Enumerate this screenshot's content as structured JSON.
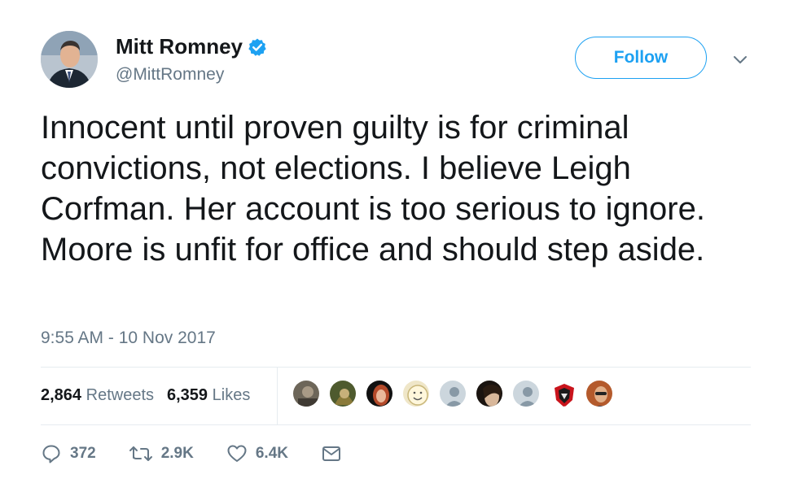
{
  "user": {
    "display_name": "Mitt Romney",
    "handle": "@MittRomney",
    "verified": true
  },
  "follow_button": {
    "label": "Follow"
  },
  "tweet": {
    "text": "Innocent until proven guilty is for criminal convictions, not elections. I believe Leigh Corfman. Her account is too serious to ignore. Moore is unfit for office and should step aside.",
    "timestamp": "9:55 AM - 10 Nov 2017"
  },
  "stats": {
    "retweets_count": "2,864",
    "retweets_label": "Retweets",
    "likes_count": "6,359",
    "likes_label": "Likes"
  },
  "actions": {
    "replies": "372",
    "retweets": "2.9K",
    "likes": "6.4K"
  },
  "colors": {
    "accent": "#1da1f2",
    "muted": "#657786",
    "text": "#14171a",
    "divider": "#e6ecf0"
  },
  "icons": [
    "verified-badge-icon",
    "chevron-down-icon",
    "reply-icon",
    "retweet-icon",
    "like-icon",
    "direct-message-icon"
  ]
}
